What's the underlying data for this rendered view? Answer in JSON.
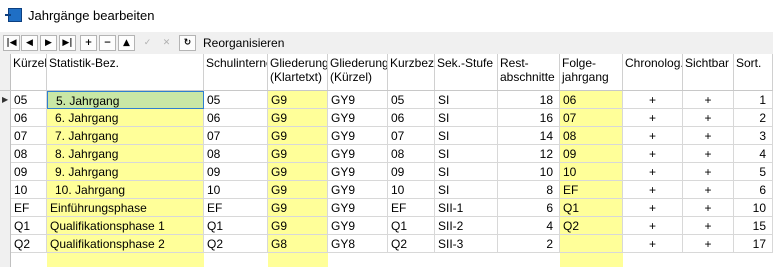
{
  "window": {
    "title": "Jahrgänge bearbeiten"
  },
  "toolbar": {
    "buttons": [
      "|◀",
      "◀",
      "▶",
      "▶|",
      "+",
      "−",
      "▲",
      "✓",
      "✕",
      "↻"
    ],
    "reorganize_label": "Reorganisieren"
  },
  "grid": {
    "headers": {
      "kuerzel": "Kürzel",
      "statistik": "Statistik-Bez.",
      "schulintern": "Schulinterne",
      "gliederung_klar": "Gliederung (Klartetxt)",
      "gliederung_kurz": "Gliederung (Kürzel)",
      "kurzbez": "Kurzbez.",
      "sekstufe": "Sek.-Stufe",
      "rest": "Rest-abschnitte",
      "folge": "Folge-jahrgang",
      "chrono": "Chronolog.",
      "sichtbar": "Sichtbar",
      "sort": "Sort."
    },
    "current_row_marker": "▶",
    "rows": [
      {
        "kuerzel": "05",
        "statistik": "5. Jahrgang",
        "schulintern": "05",
        "gliederung_klar": "G9",
        "gliederung_kurz": "GY9",
        "kurzbez": "05",
        "sekstufe": "SI",
        "rest": "18",
        "folge": "06",
        "chrono": "+",
        "sichtbar": "+",
        "sort": "1"
      },
      {
        "kuerzel": "06",
        "statistik": "6. Jahrgang",
        "schulintern": "06",
        "gliederung_klar": "G9",
        "gliederung_kurz": "GY9",
        "kurzbez": "06",
        "sekstufe": "SI",
        "rest": "16",
        "folge": "07",
        "chrono": "+",
        "sichtbar": "+",
        "sort": "2"
      },
      {
        "kuerzel": "07",
        "statistik": "7. Jahrgang",
        "schulintern": "07",
        "gliederung_klar": "G9",
        "gliederung_kurz": "GY9",
        "kurzbez": "07",
        "sekstufe": "SI",
        "rest": "14",
        "folge": "08",
        "chrono": "+",
        "sichtbar": "+",
        "sort": "3"
      },
      {
        "kuerzel": "08",
        "statistik": "8. Jahrgang",
        "schulintern": "08",
        "gliederung_klar": "G9",
        "gliederung_kurz": "GY9",
        "kurzbez": "08",
        "sekstufe": "SI",
        "rest": "12",
        "folge": "09",
        "chrono": "+",
        "sichtbar": "+",
        "sort": "4"
      },
      {
        "kuerzel": "09",
        "statistik": "9. Jahrgang",
        "schulintern": "09",
        "gliederung_klar": "G9",
        "gliederung_kurz": "GY9",
        "kurzbez": "09",
        "sekstufe": "SI",
        "rest": "10",
        "folge": "10",
        "chrono": "+",
        "sichtbar": "+",
        "sort": "5"
      },
      {
        "kuerzel": "10",
        "statistik": "10. Jahrgang",
        "schulintern": "10",
        "gliederung_klar": "G9",
        "gliederung_kurz": "GY9",
        "kurzbez": "10",
        "sekstufe": "SI",
        "rest": "8",
        "folge": "EF",
        "chrono": "+",
        "sichtbar": "+",
        "sort": "6"
      },
      {
        "kuerzel": "EF",
        "statistik": "Einführungsphase",
        "schulintern": "EF",
        "gliederung_klar": "G9",
        "gliederung_kurz": "GY9",
        "kurzbez": "EF",
        "sekstufe": "SII-1",
        "rest": "6",
        "folge": "Q1",
        "chrono": "+",
        "sichtbar": "+",
        "sort": "10"
      },
      {
        "kuerzel": "Q1",
        "statistik": "Qualifikationsphase 1",
        "schulintern": "Q1",
        "gliederung_klar": "G9",
        "gliederung_kurz": "GY9",
        "kurzbez": "Q1",
        "sekstufe": "SII-2",
        "rest": "4",
        "folge": "Q2",
        "chrono": "+",
        "sichtbar": "+",
        "sort": "15"
      },
      {
        "kuerzel": "Q2",
        "statistik": "Qualifikationsphase 2",
        "schulintern": "Q2",
        "gliederung_klar": "G8",
        "gliederung_kurz": "GY8",
        "kurzbez": "Q2",
        "sekstufe": "SII-3",
        "rest": "2",
        "folge": "",
        "chrono": "+",
        "sichtbar": "+",
        "sort": "17"
      }
    ]
  },
  "colors": {
    "editable": "#ffff99",
    "selected": "#c9e7a5",
    "selection_border": "#2f7fd0"
  }
}
